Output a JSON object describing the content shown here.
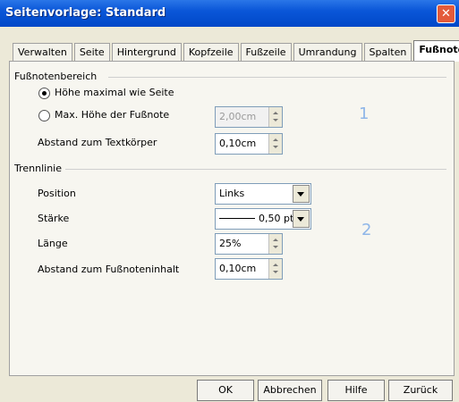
{
  "window": {
    "title": "Seitenvorlage: Standard",
    "close_icon": "close-icon"
  },
  "tabs": [
    {
      "label": "Verwalten"
    },
    {
      "label": "Seite"
    },
    {
      "label": "Hintergrund"
    },
    {
      "label": "Kopfzeile"
    },
    {
      "label": "Fußzeile"
    },
    {
      "label": "Umrandung"
    },
    {
      "label": "Spalten"
    },
    {
      "label": "Fußnote",
      "active": true
    }
  ],
  "footnote_area": {
    "section_label": "Fußnotenbereich",
    "option_max_page_label": "Höhe maximal wie Seite",
    "option_max_footnote_label": "Max. Höhe der Fußnote",
    "max_footnote_value": "2,00cm",
    "spacing_label": "Abstand zum Textkörper",
    "spacing_value": "0,10cm",
    "marker": "1"
  },
  "separator": {
    "section_label": "Trennlinie",
    "position_label": "Position",
    "position_value": "Links",
    "weight_label": "Stärke",
    "weight_value": "0,50 pt",
    "length_label": "Länge",
    "length_value": "25%",
    "content_spacing_label": "Abstand zum Fußnoteninhalt",
    "content_spacing_value": "0,10cm",
    "marker": "2"
  },
  "buttons": {
    "ok": "OK",
    "cancel": "Abbrechen",
    "help": "Hilfe",
    "back": "Zurück"
  }
}
